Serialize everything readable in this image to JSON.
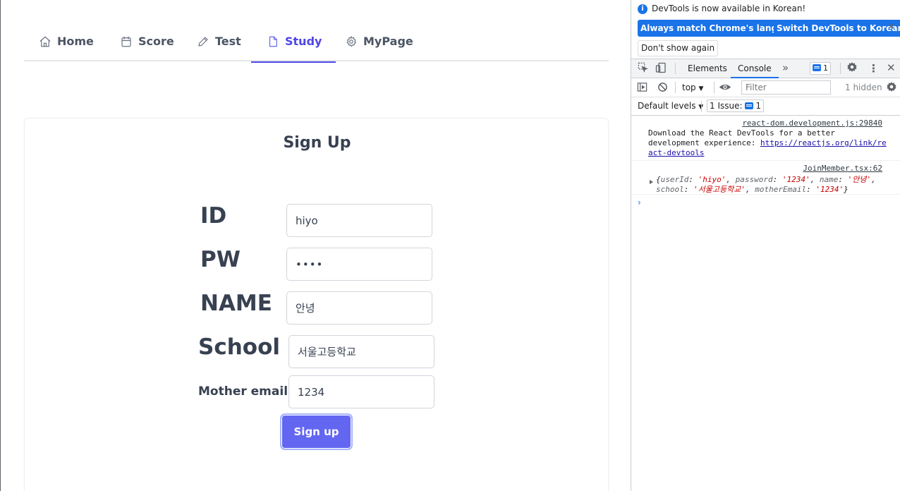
{
  "nav": {
    "tabs": [
      {
        "label": "Home",
        "icon": "home-icon"
      },
      {
        "label": "Score",
        "icon": "calendar-icon"
      },
      {
        "label": "Test",
        "icon": "pencil-icon"
      },
      {
        "label": "Study",
        "icon": "document-icon",
        "active": true
      },
      {
        "label": "MyPage",
        "icon": "gear-icon"
      }
    ]
  },
  "form": {
    "title": "Sign Up",
    "fields": [
      {
        "label": "ID",
        "value": "hiyo"
      },
      {
        "label": "PW",
        "value": "••••"
      },
      {
        "label": "NAME",
        "value": "안녕"
      },
      {
        "label": "School",
        "value": "서울고등학교"
      },
      {
        "label": "Mother email",
        "value": "1234"
      }
    ],
    "submit_label": "Sign up"
  },
  "colors": {
    "accent": "#4f46e5",
    "button": "#6366f1",
    "devtools_blue": "#1a73e8"
  },
  "devtools": {
    "infobar": {
      "message": "DevTools is now available in Korean!",
      "primary_button_1": "Always match Chrome's language",
      "primary_button_2": "Switch DevTools to Korean",
      "secondary_button": "Don't show again"
    },
    "tabs": {
      "elements": "Elements",
      "console": "Console",
      "more": "»",
      "issues_count": "1"
    },
    "toolbar": {
      "context": "top",
      "filter_placeholder": "Filter",
      "hidden": "1 hidden"
    },
    "levels": {
      "default_levels": "Default levels",
      "issues_label": "1 Issue:",
      "issues_count": "1"
    },
    "messages": {
      "m1": {
        "source": "react-dom.development.js:29840",
        "line1": "Download the React DevTools for a better",
        "line2_prefix": "development experience: ",
        "link_part1": "https://reactjs.org/link/re",
        "link_part2": "act-devtools"
      },
      "m2": {
        "source": "JoinMember.tsx:62",
        "open": "{",
        "k1": "userId",
        "v1": "'hiyo'",
        "k2": "password",
        "v2": "'1234'",
        "k3": "name",
        "v3": "'안녕'",
        "k4": "school",
        "v4": "'서울고등학교'",
        "k5": "motherEmail",
        "v5": "'1234'",
        "close": "}"
      }
    },
    "prompt": "›"
  }
}
